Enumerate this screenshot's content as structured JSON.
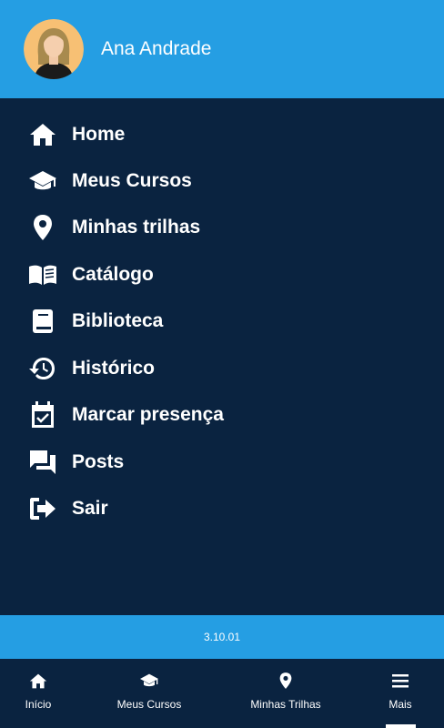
{
  "profile": {
    "name": "Ana Andrade",
    "avatar_icon": "avatar-woman-icon"
  },
  "menu": {
    "items": [
      {
        "label": "Home",
        "icon": "home-icon"
      },
      {
        "label": "Meus Cursos",
        "icon": "graduation-cap-icon"
      },
      {
        "label": "Minhas trilhas",
        "icon": "map-pin-icon"
      },
      {
        "label": "Catálogo",
        "icon": "open-book-icon"
      },
      {
        "label": "Biblioteca",
        "icon": "book-icon"
      },
      {
        "label": "Histórico",
        "icon": "history-icon"
      },
      {
        "label": "Marcar presença",
        "icon": "calendar-check-icon"
      },
      {
        "label": "Posts",
        "icon": "forum-icon"
      },
      {
        "label": "Sair",
        "icon": "logout-icon"
      }
    ]
  },
  "version": "3.10.01",
  "bottom_nav": {
    "items": [
      {
        "label": "Início",
        "icon": "home-icon"
      },
      {
        "label": "Meus Cursos",
        "icon": "graduation-cap-icon"
      },
      {
        "label": "Minhas Trilhas",
        "icon": "map-pin-icon"
      },
      {
        "label": "Mais",
        "icon": "menu-icon",
        "active": true
      }
    ]
  },
  "colors": {
    "primary": "#259ee3",
    "background": "#0a2340",
    "text": "#ffffff"
  }
}
